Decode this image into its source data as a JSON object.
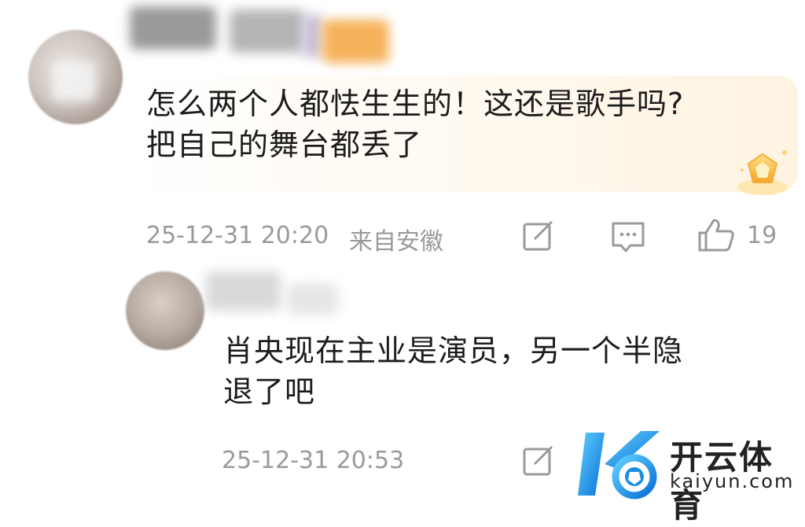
{
  "comment": {
    "text_line1": "怎么两个人都怯生生的！这还是歌手吗?",
    "text_line2": "把自己的舞台都丢了",
    "timestamp": "25-12-31 20:20",
    "location": "来自安徽",
    "like_count": "19",
    "icons": [
      "share-icon",
      "comment-icon",
      "like-icon",
      "vip-badge-icon"
    ]
  },
  "reply": {
    "text_line1": "肖央现在主业是演员，另一个半隐",
    "text_line2": "退了吧",
    "timestamp": "25-12-31 20:53",
    "icons": [
      "share-icon"
    ]
  },
  "watermark": {
    "title": "开云体育",
    "subtitle": "kaiyun.com"
  },
  "colors": {
    "meta_gray": "#9a9a9a",
    "bubble_tint": "#fff3e2",
    "logo_blue": "#1a8fe0"
  }
}
